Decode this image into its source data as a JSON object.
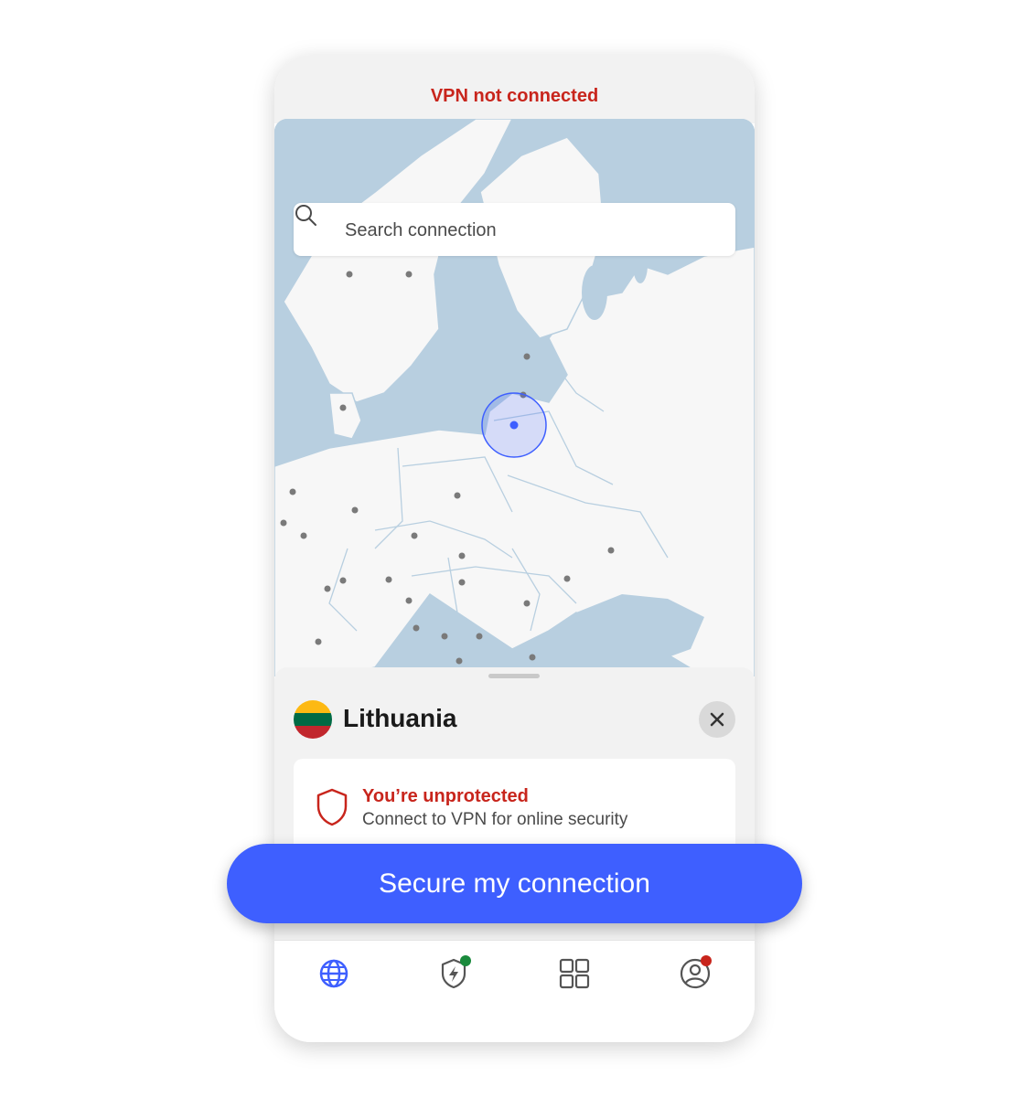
{
  "status": {
    "text": "VPN not connected",
    "color": "#c8251c"
  },
  "search": {
    "placeholder": "Search connection",
    "icon": "search-icon"
  },
  "map": {
    "selected_country": "Lithuania",
    "marker_color": "#3e5fff"
  },
  "sheet": {
    "country": "Lithuania",
    "flag_colors": [
      "#fdb913",
      "#006a44",
      "#c1272d"
    ],
    "close_icon": "close-icon",
    "status_title": "You’re unprotected",
    "status_subtitle": "Connect to VPN for online security",
    "status_icon": "shield-icon"
  },
  "cta": {
    "label": "Secure my connection",
    "color": "#3e5fff"
  },
  "tabs": [
    {
      "icon": "globe-icon",
      "active": true
    },
    {
      "icon": "shield-bolt-icon",
      "badge": "#1a8a3c"
    },
    {
      "icon": "grid-icon"
    },
    {
      "icon": "profile-icon",
      "badge": "#c8251c"
    }
  ]
}
